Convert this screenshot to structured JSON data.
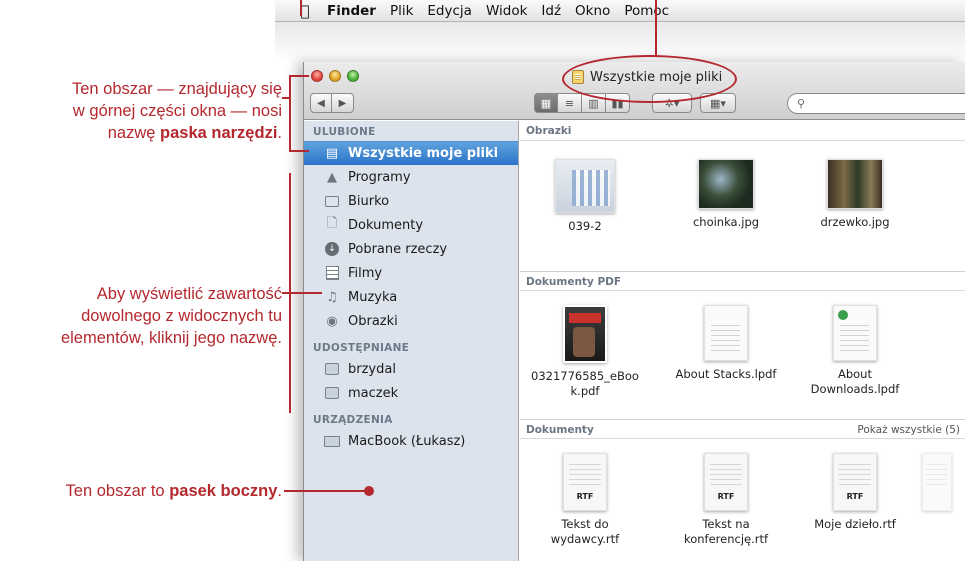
{
  "menubar": {
    "apple_icon": "apple-icon",
    "items": [
      "Finder",
      "Plik",
      "Edycja",
      "Widok",
      "Idź",
      "Okno",
      "Pomoc"
    ]
  },
  "window": {
    "title": "Wszystkie moje pliki",
    "toolbar": {
      "back_icon": "◀",
      "forward_icon": "▶",
      "view_icons": [
        "▦",
        "≡",
        "▥",
        "▮▮"
      ],
      "action_icon": "✲▾",
      "arrange_icon": "▦▾",
      "search_placeholder": ""
    }
  },
  "sidebar": {
    "sections": [
      {
        "header": "ULUBIONE",
        "items": [
          {
            "label": "Wszystkie moje pliki",
            "icon": "all-files-icon",
            "active": true
          },
          {
            "label": "Programy",
            "icon": "applications-icon"
          },
          {
            "label": "Biurko",
            "icon": "desktop-icon"
          },
          {
            "label": "Dokumenty",
            "icon": "documents-icon"
          },
          {
            "label": "Pobrane rzeczy",
            "icon": "downloads-icon"
          },
          {
            "label": "Filmy",
            "icon": "movies-icon"
          },
          {
            "label": "Muzyka",
            "icon": "music-icon"
          },
          {
            "label": "Obrazki",
            "icon": "pictures-icon"
          }
        ]
      },
      {
        "header": "UDOSTĘPNIANE",
        "items": [
          {
            "label": "brzydal",
            "icon": "shared-computer-icon"
          },
          {
            "label": "maczek",
            "icon": "shared-computer-icon"
          }
        ]
      },
      {
        "header": "URZĄDZENIA",
        "items": [
          {
            "label": "MacBook (Łukasz)",
            "icon": "laptop-icon"
          }
        ]
      }
    ]
  },
  "content": {
    "pictures": {
      "header": "Obrazki",
      "files": [
        "039-2",
        "choinka.jpg",
        "drzewko.jpg"
      ]
    },
    "pdfs": {
      "header": "Dokumenty PDF",
      "files": [
        {
          "line1": "0321776585_eBoo",
          "line2": "k.pdf"
        },
        {
          "line1": "About Stacks.lpdf",
          "line2": ""
        },
        {
          "line1": "About",
          "line2": "Downloads.lpdf"
        }
      ]
    },
    "documents": {
      "header": "Dokumenty",
      "show_all": "Pokaż wszystkie (5)",
      "rtf_badge": "RTF",
      "files": [
        {
          "line1": "Tekst do",
          "line2": "wydawcy.rtf"
        },
        {
          "line1": "Tekst na",
          "line2": "konferencję.rtf"
        },
        {
          "line1": "Moje dzieło.rtf",
          "line2": ""
        }
      ]
    }
  },
  "annotations": {
    "toolbar_note": {
      "line1": "Ten obszar — znajdujący się",
      "line2": "w górnej części okna — nosi",
      "line3_prefix": "nazwę ",
      "line3_bold": "paska narzędzi",
      "line3_suffix": "."
    },
    "sidebar_items_note": {
      "line1": "Aby wyświetlić zawartość",
      "line2": "dowolnego z widocznych tu",
      "line3": "elementów, kliknij jego nazwę."
    },
    "sidebar_note": {
      "prefix": "Ten obszar to ",
      "bold": "pasek boczny",
      "suffix": "."
    },
    "accent_color": "#b4282e"
  }
}
